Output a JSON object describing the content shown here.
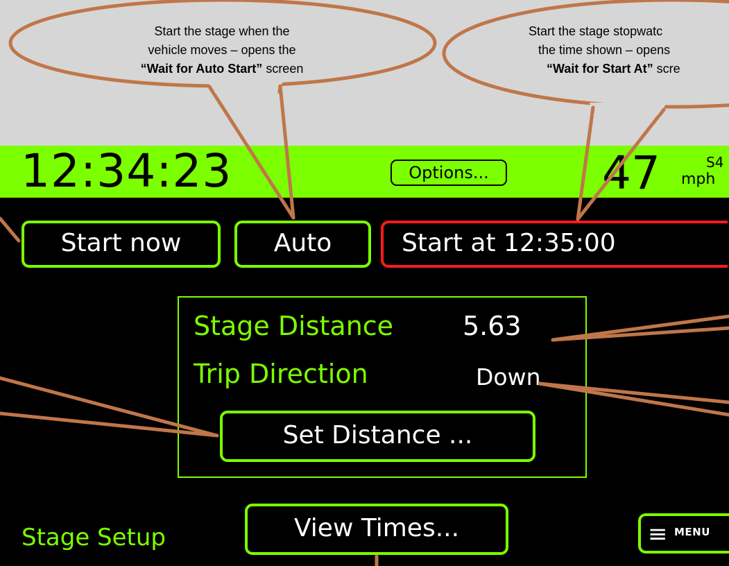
{
  "status_bar": {
    "time": "12:34:23",
    "options_label": "Options...",
    "speed": "47",
    "stage_code": "S4",
    "speed_unit": "mph"
  },
  "start_buttons": {
    "start_now": "Start now",
    "auto": "Auto",
    "start_at": "Start at 12:35:00"
  },
  "distance_panel": {
    "stage_distance_label": "Stage Distance",
    "stage_distance_value": "5.63",
    "trip_direction_label": "Trip Direction",
    "trip_direction_value": "Down",
    "set_distance_label": "Set Distance ..."
  },
  "footer": {
    "screen_name": "Stage Setup",
    "view_times_label": "View Times...",
    "menu_icon": "≡",
    "menu_label": "MENU"
  },
  "callouts": {
    "auto": {
      "line1": "Start the stage when the",
      "line2": "vehicle moves – opens the",
      "line3_bold": "“Wait for Auto Start”",
      "line3_rest": " screen"
    },
    "start_at": {
      "line1": "Start the stage stopwatc",
      "line2": "the time shown – opens",
      "line3_bold": "“Wait for Start At”",
      "line3_rest": " scre"
    }
  },
  "colors": {
    "accent_green": "#7cff00",
    "alert_red": "#ff1a1a",
    "callout_stroke": "#c0764a",
    "callout_fill": "#d6d6d6",
    "screen_background": "#000000"
  }
}
